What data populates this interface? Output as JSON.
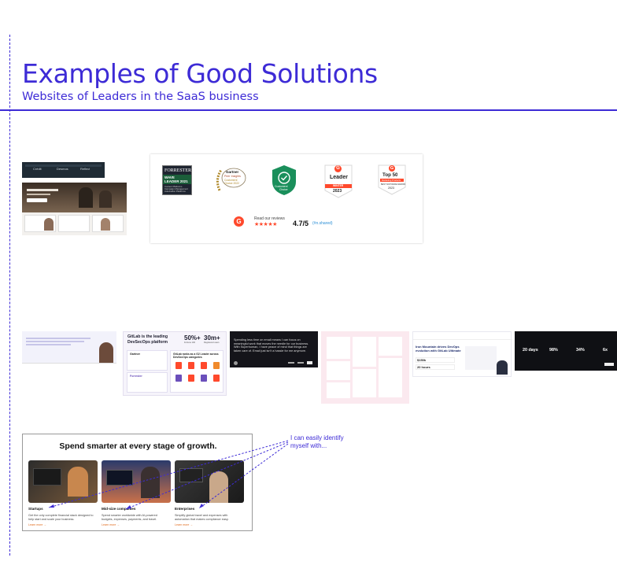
{
  "heading": {
    "title": "Examples of Good Solutions",
    "subtitle": "Websites of Leaders in the SaaS business"
  },
  "colors": {
    "accent": "#3d2bd6",
    "g2": "#ff492c",
    "forrester_green": "#1b5e3a",
    "gartner_gold": "#b08a2c"
  },
  "badges": {
    "forrester": {
      "brand": "FORRESTER",
      "line1": "WAVE",
      "line2": "LEADER 2021",
      "caption": "Content Platforms Campaign Management Automation Platforms"
    },
    "gartner": {
      "brand": "Gartner",
      "line1": "Peer Insights",
      "line2": "Customers' Choice 2022"
    },
    "green": {
      "line1": "Customers'",
      "line2": "Choice"
    },
    "g2_leader": {
      "logo": "G",
      "title": "Leader",
      "season": "WINTER",
      "year": "2023"
    },
    "g2_top50": {
      "logo": "G",
      "title": "Top 50",
      "ribbon": "Marketing Products",
      "sub": "BEST SOFTWARE AWARDS",
      "year": "2023"
    },
    "review_read": "Read our reviews",
    "stars": "★★★★★",
    "rating": "4.7/5",
    "handle": "(#n.shared)"
  },
  "thumbs": {
    "nav_logos": [
      "Crédit",
      "Desmos",
      "Reflect"
    ],
    "gitlab": {
      "headline": "GitLab is the leading DevSecOps platform",
      "stat1": "50%+",
      "stat1_label": "Fortune 100",
      "stat2": "30m+",
      "stat2_label": "Registered users",
      "card1_title": "Gartner",
      "card2_title": "Forrester",
      "card3_title": "GitLab ranks as a G2 Leader across DevSecOps categories"
    },
    "superhuman": {
      "text": "Spending less time on email means I can focus on meaningful work that moves the needle for our business. With Superhuman, I have peace of mind that things are taken care of. Email just isn't a hassle for me anymore."
    },
    "iron": {
      "headline": "Iron Mountain drives DevOps evolution with GitLab Ultimate",
      "stat1": "$150k",
      "stat2": "20 hours"
    },
    "black_stats": [
      "20 days",
      "98%",
      "34%",
      "6x"
    ]
  },
  "expense": {
    "headline": "Spend smarter at every stage of growth.",
    "tiles": [
      {
        "name": "Startups",
        "desc": "Get the only complete financial stack designed to help start and scale your business.",
        "link": "Learn more →"
      },
      {
        "name": "Mid-size companies",
        "desc": "Spend smarter worldwide with AI-powered budgets, expenses, payments, and travel.",
        "link": "Learn more →"
      },
      {
        "name": "Enterprises",
        "desc": "Simplify global travel and expenses with automation that makes compliance easy.",
        "link": "Learn more →"
      }
    ]
  },
  "annotation": "I can easily identify myself with..."
}
